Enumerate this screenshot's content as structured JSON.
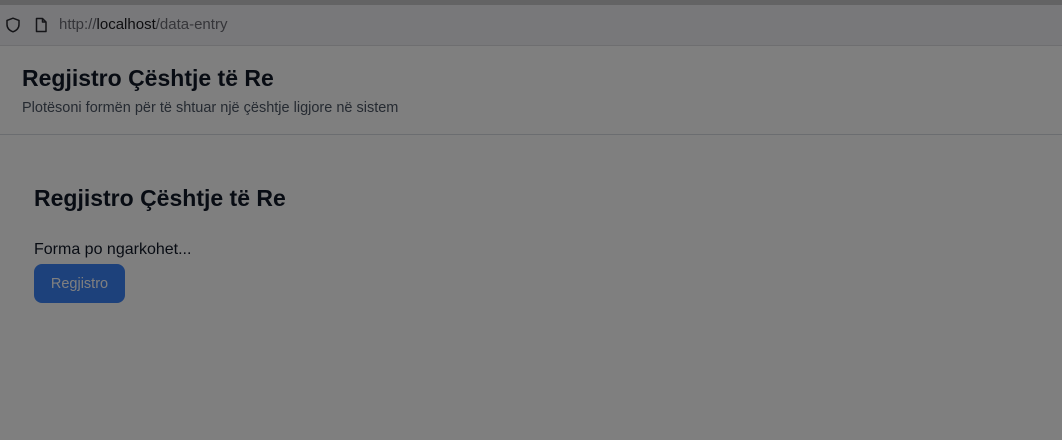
{
  "browser": {
    "url_prefix": "http://",
    "url_host": "localhost",
    "url_path": "/data-entry",
    "icons": [
      "shield-icon",
      "page-icon"
    ]
  },
  "header": {
    "title": "Regjistro Çështje të Re",
    "subtitle": "Plotësoni formën për të shtuar një çështje ligjore në sistem"
  },
  "main": {
    "form_title": "Regjistro Çështje të Re",
    "loading_text": "Forma po ngarkohet...",
    "submit_label": "Regjistro"
  },
  "colors": {
    "overlay": "rgba(0,0,0,0.5)",
    "primary_button": "#3b82f6"
  }
}
